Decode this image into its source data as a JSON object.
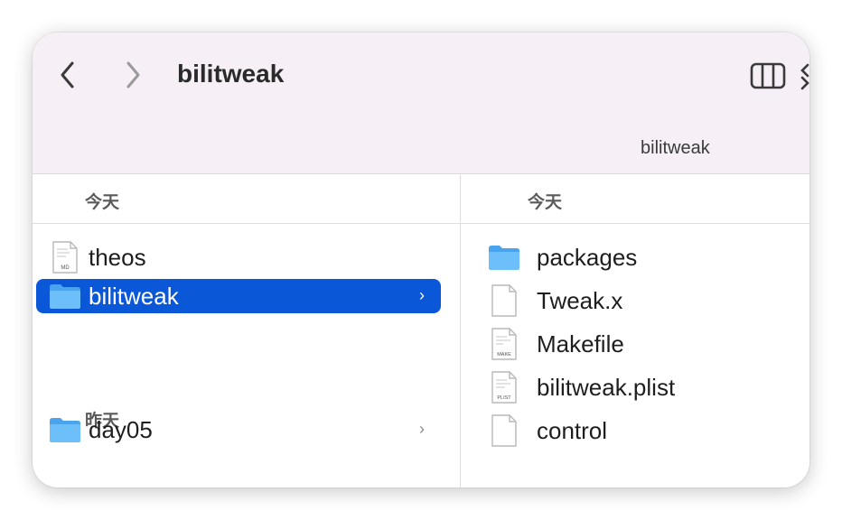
{
  "window": {
    "title": "bilitweak",
    "path_label": "bilitweak"
  },
  "left_column": {
    "header": "今天",
    "items_today": [
      {
        "name": "theos",
        "icon": "markdown-file-icon",
        "badge": "MD"
      },
      {
        "name": "bilitweak",
        "icon": "folder-icon",
        "selected": true
      }
    ],
    "group_yesterday": "昨天",
    "items_yesterday": [
      {
        "name": "day05",
        "icon": "folder-icon"
      }
    ]
  },
  "right_column": {
    "header": "今天",
    "items": [
      {
        "name": "packages",
        "icon": "folder-icon"
      },
      {
        "name": "Tweak.x",
        "icon": "blank-file-icon"
      },
      {
        "name": "Makefile",
        "icon": "make-file-icon",
        "badge": "MAKE"
      },
      {
        "name": "bilitweak.plist",
        "icon": "plist-file-icon",
        "badge": "PLIST"
      },
      {
        "name": "control",
        "icon": "blank-file-icon"
      }
    ]
  },
  "colors": {
    "selection": "#0a57d8",
    "folder": "#5ab4f5",
    "toolbar_bg": "#f6eff6"
  }
}
